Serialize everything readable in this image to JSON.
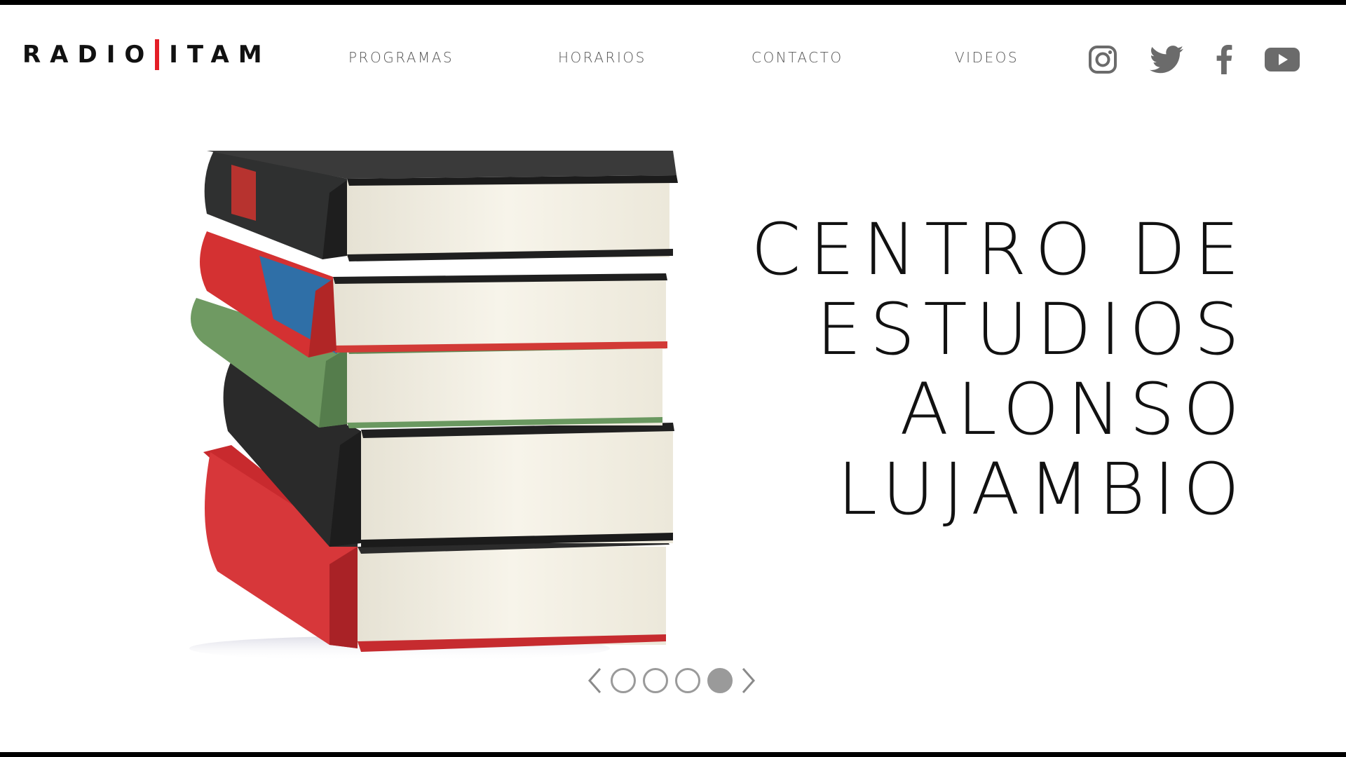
{
  "logo": {
    "left": "RADIO",
    "right": "ITAM"
  },
  "nav": [
    {
      "label": "PROGRAMAS"
    },
    {
      "label": "HORARIOS"
    },
    {
      "label": "CONTACTO"
    },
    {
      "label": "VIDEOS"
    }
  ],
  "social": [
    "instagram-icon",
    "twitter-icon",
    "facebook-icon",
    "youtube-icon"
  ],
  "hero": {
    "headline": [
      "CENTRO DE",
      "ESTUDIOS",
      "ALONSO",
      "LUJAMBIO"
    ]
  },
  "slider": {
    "total": 4,
    "active_index": 4
  },
  "colors": {
    "accent": "#e41e26",
    "icon": "#6b6b6b",
    "text": "#111111"
  }
}
